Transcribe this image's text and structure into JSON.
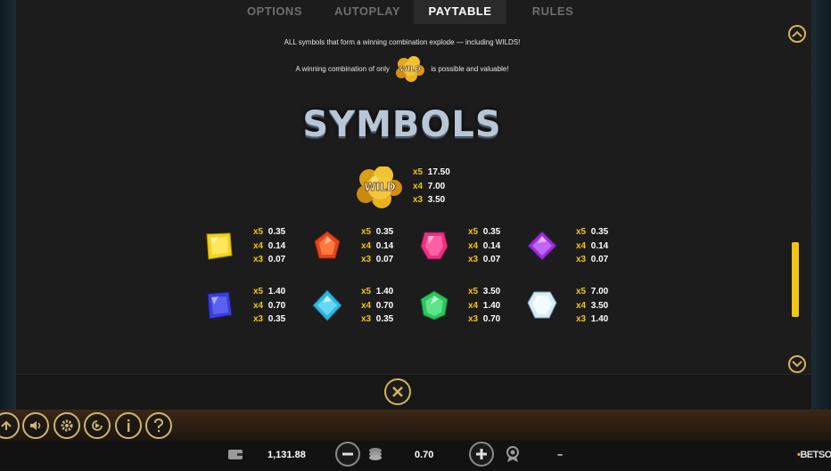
{
  "tabs": [
    {
      "label": "OPTIONS",
      "active": false
    },
    {
      "label": "AUTOPLAY",
      "active": false
    },
    {
      "label": "PAYTABLE",
      "active": true
    },
    {
      "label": "RULES",
      "active": false
    }
  ],
  "paytable": {
    "line1": "ALL symbols that form a winning combination explode — including WILDS!",
    "line2_before": "A winning combination of only",
    "line2_after": "is possible and valuable!",
    "wild_label": "WILD",
    "section_title": "SYMBOLS",
    "wild_pays": [
      {
        "mult": "x5",
        "value": "17.50"
      },
      {
        "mult": "x4",
        "value": "7.00"
      },
      {
        "mult": "x3",
        "value": "3.50"
      }
    ],
    "gems": [
      {
        "name": "yellow",
        "color": "#f2d21b",
        "pays": [
          {
            "mult": "x5",
            "value": "0.35"
          },
          {
            "mult": "x4",
            "value": "0.14"
          },
          {
            "mult": "x3",
            "value": "0.07"
          }
        ]
      },
      {
        "name": "orange",
        "color": "#e8451c",
        "pays": [
          {
            "mult": "x5",
            "value": "0.35"
          },
          {
            "mult": "x4",
            "value": "0.14"
          },
          {
            "mult": "x3",
            "value": "0.07"
          }
        ]
      },
      {
        "name": "pink",
        "color": "#e8337f",
        "pays": [
          {
            "mult": "x5",
            "value": "0.35"
          },
          {
            "mult": "x4",
            "value": "0.14"
          },
          {
            "mult": "x3",
            "value": "0.07"
          }
        ]
      },
      {
        "name": "purple",
        "color": "#9a2fd6",
        "pays": [
          {
            "mult": "x5",
            "value": "0.35"
          },
          {
            "mult": "x4",
            "value": "0.14"
          },
          {
            "mult": "x3",
            "value": "0.07"
          }
        ]
      },
      {
        "name": "blue",
        "color": "#3b3fd6",
        "pays": [
          {
            "mult": "x5",
            "value": "1.40"
          },
          {
            "mult": "x4",
            "value": "0.70"
          },
          {
            "mult": "x3",
            "value": "0.35"
          }
        ]
      },
      {
        "name": "cyan",
        "color": "#2fb8e0",
        "pays": [
          {
            "mult": "x5",
            "value": "1.40"
          },
          {
            "mult": "x4",
            "value": "0.70"
          },
          {
            "mult": "x3",
            "value": "0.35"
          }
        ]
      },
      {
        "name": "green",
        "color": "#2fc25b",
        "pays": [
          {
            "mult": "x5",
            "value": "3.50"
          },
          {
            "mult": "x4",
            "value": "1.40"
          },
          {
            "mult": "x3",
            "value": "0.70"
          }
        ]
      },
      {
        "name": "white",
        "color": "#d8ecf7",
        "pays": [
          {
            "mult": "x5",
            "value": "7.00"
          },
          {
            "mult": "x4",
            "value": "3.50"
          },
          {
            "mult": "x3",
            "value": "1.40"
          }
        ]
      }
    ]
  },
  "bottom_bar": {
    "balance": "1,131.88",
    "bet": "0.70",
    "win": "–",
    "brand": "BETSOFT",
    "brand_dot": "•"
  },
  "colors": {
    "accent": "#f0c419",
    "button_border": "#d4b45c",
    "panel": "#1c1c1c"
  },
  "icons": [
    "wallet-icon",
    "minus-icon",
    "coins-icon",
    "plus-icon",
    "badge-icon",
    "home-icon",
    "sound-icon",
    "settings-icon",
    "autoplay-icon",
    "info-icon",
    "help-icon",
    "close-icon",
    "chevron-up-icon",
    "chevron-down-icon"
  ]
}
